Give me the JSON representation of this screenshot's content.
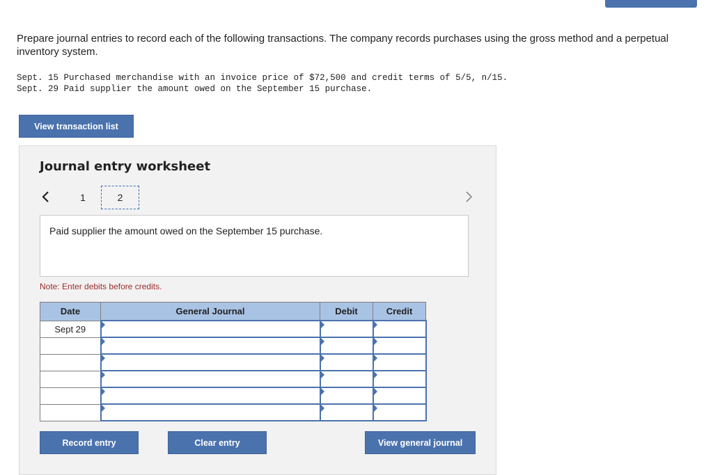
{
  "intro": "Prepare journal entries to record each of the following transactions. The company records purchases using the gross method and a perpetual inventory system.",
  "transactions": [
    "Sept. 15 Purchased merchandise with an invoice price of $72,500 and credit terms of 5/5, n/15.",
    "Sept. 29 Paid supplier the amount owed on the September 15 purchase."
  ],
  "buttons": {
    "view_transactions": "View transaction list",
    "record_entry": "Record entry",
    "clear_entry": "Clear entry",
    "view_general_journal": "View general journal"
  },
  "worksheet": {
    "title": "Journal entry worksheet",
    "pages": [
      "1",
      "2"
    ],
    "active_page": "2",
    "description": "Paid supplier the amount owed on the September 15 purchase.",
    "note": "Note: Enter debits before credits."
  },
  "journal": {
    "columns": [
      "Date",
      "General Journal",
      "Debit",
      "Credit"
    ],
    "rows": [
      {
        "date": "Sept 29",
        "account": "",
        "debit": "",
        "credit": ""
      },
      {
        "date": "",
        "account": "",
        "debit": "",
        "credit": ""
      },
      {
        "date": "",
        "account": "",
        "debit": "",
        "credit": ""
      },
      {
        "date": "",
        "account": "",
        "debit": "",
        "credit": ""
      },
      {
        "date": "",
        "account": "",
        "debit": "",
        "credit": ""
      },
      {
        "date": "",
        "account": "",
        "debit": "",
        "credit": ""
      }
    ]
  },
  "colors": {
    "button": "#4a72ad",
    "table_header": "#a9c3e4",
    "note_text": "#9b2a2a",
    "worksheet_bg": "#f2f2f2"
  },
  "icons": {
    "prev": "chevron-left-icon",
    "next": "chevron-right-icon"
  }
}
